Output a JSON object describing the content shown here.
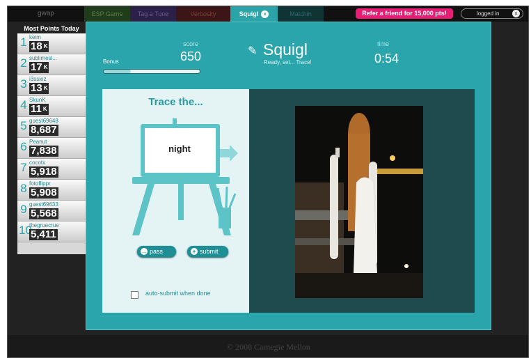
{
  "nav": {
    "brand": "gwap",
    "tabs": [
      "ESP Game",
      "Tag a Tune",
      "Verbosity",
      "Squigl",
      "Matchin"
    ],
    "active_close": "×",
    "refer": "Refer a friend for 15,000 pts!",
    "login": "logged in",
    "login_close": "×"
  },
  "leaderboard": {
    "title": "Most Points Today",
    "rows": [
      {
        "rank": "1",
        "name": "keim",
        "points": "18",
        "suffix": "K"
      },
      {
        "rank": "2",
        "name": "sublimesl...",
        "points": "17",
        "suffix": "K"
      },
      {
        "rank": "3",
        "name": "i3ssiez",
        "points": "13",
        "suffix": "K"
      },
      {
        "rank": "4",
        "name": "SkunK",
        "points": "11",
        "suffix": "K"
      },
      {
        "rank": "5",
        "name": "guest69648",
        "points": "8,687",
        "suffix": ""
      },
      {
        "rank": "6",
        "name": "Peanut",
        "points": "7,838",
        "suffix": ""
      },
      {
        "rank": "7",
        "name": "cocotx",
        "points": "5,918",
        "suffix": ""
      },
      {
        "rank": "8",
        "name": "fotoflippr",
        "points": "5,908",
        "suffix": ""
      },
      {
        "rank": "9",
        "name": "guest69633",
        "points": "5,568",
        "suffix": ""
      },
      {
        "rank": "10",
        "name": "thegruecrue",
        "points": "5,411",
        "suffix": ""
      }
    ]
  },
  "game": {
    "score_label": "score",
    "score": "650",
    "bonus_label": "Bonus",
    "bonus_level": 0.28,
    "title": "Squigl",
    "subtitle": "Ready, set... Trace!",
    "time_label": "time",
    "time": "0:54",
    "prompt": "Trace the...",
    "word": "night",
    "pass": "pass",
    "submit": "submit",
    "auto_submit": "auto-submit when done",
    "accent": "#2aa5ab"
  },
  "footer": {
    "prefix": "© 2008",
    "org": "Carnegie Mellon"
  }
}
